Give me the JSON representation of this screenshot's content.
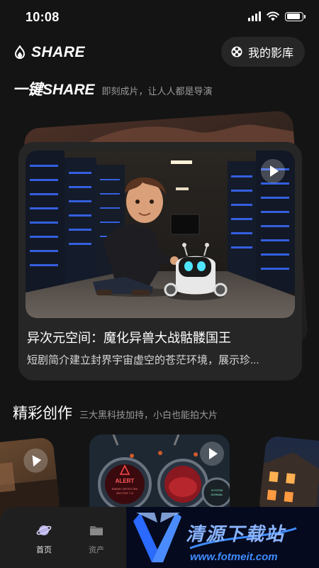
{
  "status_bar": {
    "time": "10:08",
    "battery_level": 0.9
  },
  "header": {
    "logo_text": "SHARE",
    "library_button": "我的影库"
  },
  "hero_section": {
    "title": "一键SHARE",
    "subtitle": "即刻成片，让人人都是导演"
  },
  "featured": {
    "title": "异次元空间：魔化异兽大战骷髅国王",
    "description": "短剧简介建立封界宇宙虚空的苍茫环境，展示珍..."
  },
  "creations_section": {
    "title": "精彩创作",
    "subtitle": "三大黑科技加持，小白也能拍大片",
    "items": [
      {
        "image_text": []
      },
      {
        "image_text": [
          "ALERT",
          "ENEMY DETECTED",
          "SECTOR 7-G",
          "SYSTEM",
          "NORMAL"
        ]
      },
      {
        "image_text": []
      }
    ]
  },
  "tab_bar": {
    "tabs": [
      {
        "label": "首页"
      },
      {
        "label": "资产"
      }
    ]
  },
  "watermark": {
    "name": "清源下载站",
    "url": "www.fotmeit.com"
  },
  "colors": {
    "background": "#141414",
    "card": "#262626",
    "tab_bar": "#1f1f1f",
    "accent_blue": "#3f8cff"
  }
}
